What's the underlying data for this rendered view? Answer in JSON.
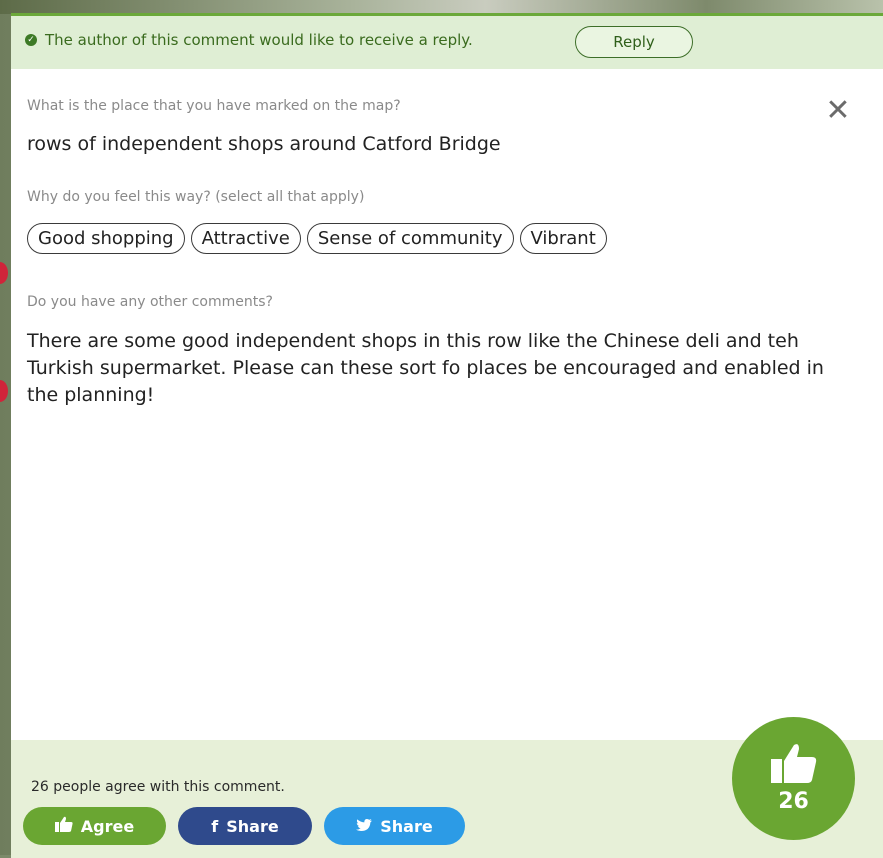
{
  "reply_bar": {
    "message": "The author of this comment would like to receive a reply.",
    "reply_label": "Reply"
  },
  "questions": {
    "place_label": "What is the place that you have marked on the map?",
    "place_answer": "rows of independent shops around Catford Bridge",
    "why_label": "Why do you feel this way? (select all that apply)",
    "tags": [
      "Good shopping",
      "Attractive",
      "Sense of community",
      "Vibrant"
    ],
    "comments_label": "Do you have any other comments?",
    "comments_answer": "There are some good independent shops in this row like the Chinese deli and teh Turkish supermarket. Please can these sort fo places be encouraged and enabled in the planning!"
  },
  "footer": {
    "agree_text": "26 people agree with this comment.",
    "agree_label": "Agree",
    "facebook_share_label": "Share",
    "twitter_share_label": "Share",
    "like_count": "26"
  },
  "colors": {
    "accent_green": "#6aa632",
    "reply_bar_bg": "#dfeed4",
    "footer_bg": "#e7f0d8",
    "facebook_blue": "#2f4a8c",
    "twitter_blue": "#2c9be6"
  },
  "icons": [
    "check-circle-icon",
    "close-icon",
    "thumbs-up-icon",
    "facebook-icon",
    "twitter-icon"
  ]
}
